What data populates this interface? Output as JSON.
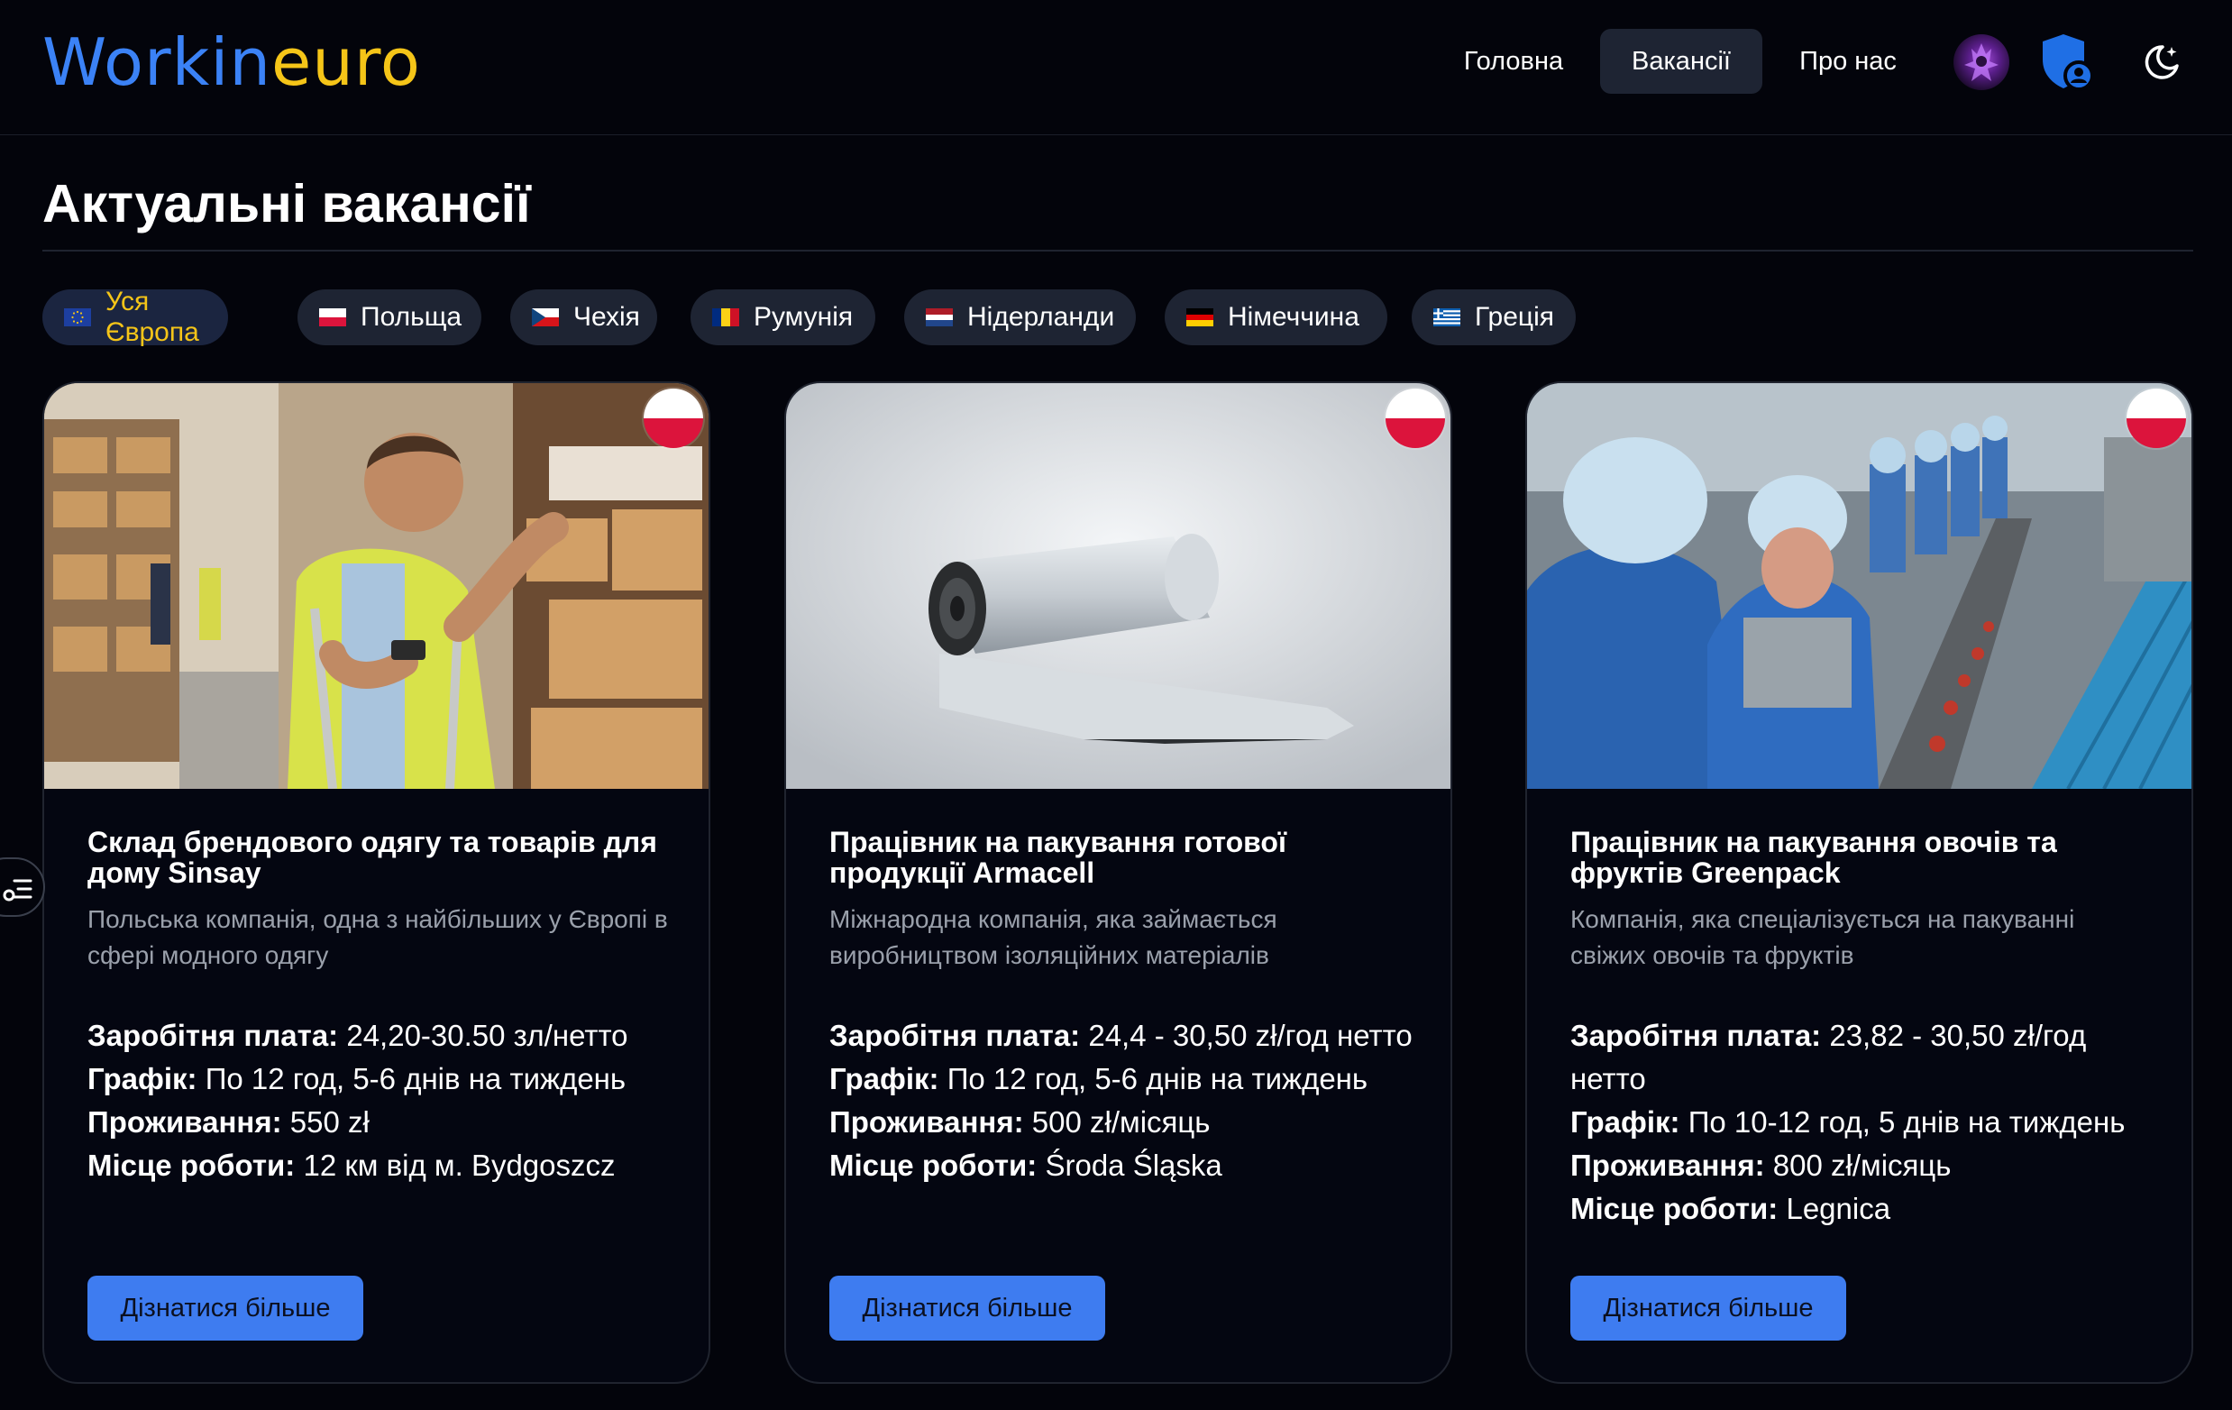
{
  "header": {
    "logo_part1": "Workin",
    "logo_part2": "euro",
    "nav": [
      {
        "label": "Головна",
        "active": false
      },
      {
        "label": "Вакансії",
        "active": true
      },
      {
        "label": "Про нас",
        "active": false
      }
    ],
    "icons": [
      "avatar",
      "shield-user-icon",
      "moon-icon"
    ]
  },
  "page": {
    "title": "Актуальні вакансії"
  },
  "filters": [
    {
      "label": "Уся Європа",
      "flag": "eu",
      "active": true
    },
    {
      "label": "Польща",
      "flag": "pl"
    },
    {
      "label": "Чехія",
      "flag": "cz"
    },
    {
      "label": "Румунія",
      "flag": "ro"
    },
    {
      "label": "Нідерланди",
      "flag": "nl"
    },
    {
      "label": "Німеччина",
      "flag": "de"
    },
    {
      "label": "Греція",
      "flag": "gr"
    }
  ],
  "labels": {
    "salary": "Заробітня плата:",
    "schedule": "Графік:",
    "housing": "Проживання:",
    "location": "Місце роботи:"
  },
  "jobs": [
    {
      "country_flag": "pl",
      "image": "warehouse-worker-photo",
      "title": "Склад брендового одягу та товарів для дому Sinsay",
      "description": "Польська компанія, одна з найбільших у Європі в сфері модного одягу",
      "salary": "24,20-30.50 зл/нетто",
      "schedule": "По 12 год, 5-6 днів на тиждень",
      "housing": "550 zł",
      "location": "12 км від м. Bydgoszcz",
      "button": "Дізнатися більше"
    },
    {
      "country_flag": "pl",
      "image": "insulation-roll-photo",
      "title": "Працівник на пакування готової продукції Armacell",
      "description": "Міжнародна компанія, яка займається виробництвом ізоляційних матеріалів",
      "salary": "24,4 - 30,50 zł/год нетто",
      "schedule": "По 12 год, 5-6 днів на тиждень",
      "housing": "500 zł/місяць",
      "location": "Środa Śląska",
      "button": "Дізнатися більше"
    },
    {
      "country_flag": "pl",
      "image": "food-packing-line-photo",
      "title": "Працівник на пакування овочів та фруктів Greenpack",
      "description": "Компанія, яка спеціалізується на пакуванні свіжих овочів та фруктів",
      "salary": "23,82 - 30,50 zł/год нетто",
      "schedule": "По 10-12 год, 5 днів на тиждень",
      "housing": "800 zł/місяць",
      "location": "Legnica",
      "button": "Дізнатися більше"
    }
  ],
  "colors": {
    "background": "#03040b",
    "accent_blue": "#3e7cf0",
    "logo_blue": "#3b82f6",
    "logo_yellow": "#f5c518",
    "chip_bg": "#1e2433"
  }
}
